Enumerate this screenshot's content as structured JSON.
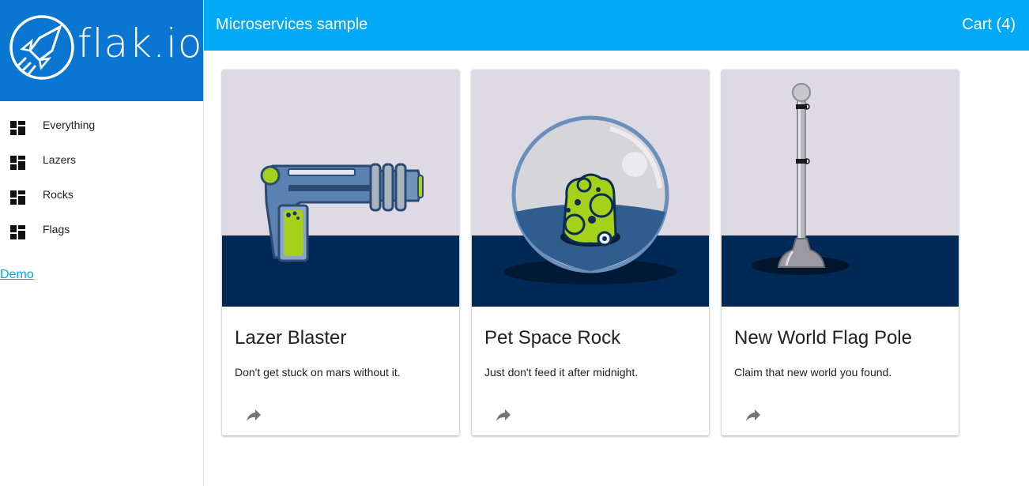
{
  "brand": {
    "logo_text": "flak.io",
    "logo_icon": "rocket-circle-icon",
    "color": "#0a76d1"
  },
  "header": {
    "title": "Microservices sample",
    "cart_label": "Cart (4)",
    "color": "#03a9f4"
  },
  "sidebar": {
    "items": [
      {
        "label": "Everything",
        "icon": "dashboard-icon"
      },
      {
        "label": "Lazers",
        "icon": "dashboard-icon"
      },
      {
        "label": "Rocks",
        "icon": "dashboard-icon"
      },
      {
        "label": "Flags",
        "icon": "dashboard-icon"
      }
    ],
    "demo_link": "Demo"
  },
  "products": [
    {
      "title": "Lazer Blaster",
      "description": "Don't get stuck on mars without it.",
      "image": "lazer-blaster",
      "action_icon": "share-icon"
    },
    {
      "title": "Pet Space Rock",
      "description": "Just don't feed it after midnight.",
      "image": "pet-space-rock",
      "action_icon": "share-icon"
    },
    {
      "title": "New World Flag Pole",
      "description": "Claim that new world you found.",
      "image": "flag-pole",
      "action_icon": "share-icon"
    }
  ]
}
